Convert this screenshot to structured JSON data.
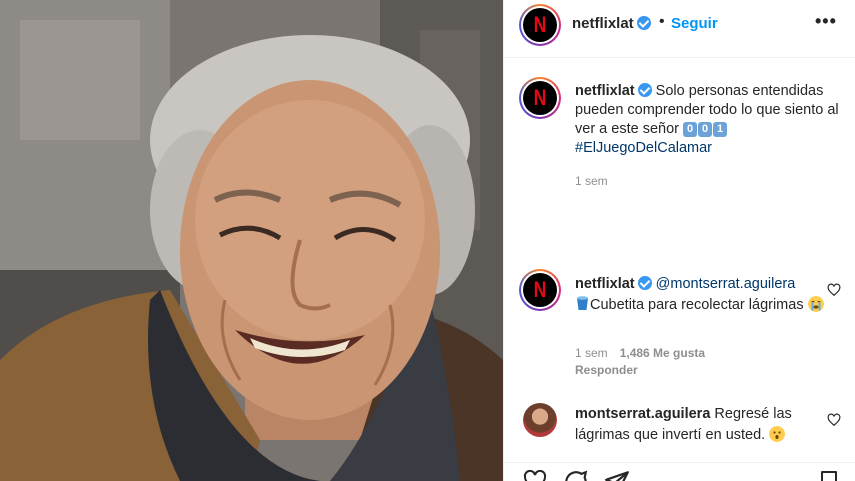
{
  "header": {
    "username": "netflixlat",
    "separator": "•",
    "follow_label": "Seguir",
    "more_label": "•••",
    "avatar_letter": "N"
  },
  "caption": {
    "username": "netflixlat",
    "text": "Solo personas entendidas pueden comprender todo lo que siento al ver a este señor",
    "keycaps": [
      "0",
      "0",
      "1"
    ],
    "hashtag": "#ElJuegoDelCalamar",
    "time": "1 sem"
  },
  "comments": [
    {
      "username": "netflixlat",
      "mention": "@montserrat.aguilera",
      "text_line": "Cubetita para recolectar lágrimas",
      "time": "1 sem",
      "likes": "1,486 Me gusta",
      "reply_label": "Responder"
    },
    {
      "username": "montserrat.aguilera",
      "text": "Regresé las lágrimas que invertí en usted."
    }
  ],
  "colors": {
    "accent": "#0095f6",
    "verified": "#3897f0",
    "netflix_red": "#e50914",
    "secondary_text": "#8e8e8e"
  },
  "icons": [
    "verified-icon",
    "more-icon",
    "heart-icon",
    "comment-icon",
    "share-icon",
    "bookmark-icon",
    "bucket-emoji",
    "crying-emoji",
    "hushed-emoji"
  ]
}
